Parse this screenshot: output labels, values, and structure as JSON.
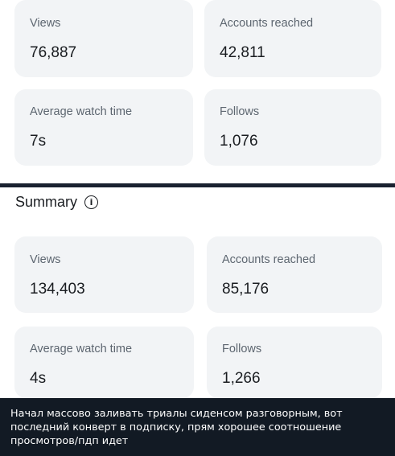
{
  "top_stats": {
    "views": {
      "label": "Views",
      "value": "76,887"
    },
    "accounts_reached": {
      "label": "Accounts reached",
      "value": "42,811"
    },
    "average_watch_time": {
      "label": "Average watch time",
      "value": "7s"
    },
    "follows": {
      "label": "Follows",
      "value": "1,076"
    }
  },
  "summary": {
    "title": "Summary",
    "info_icon": "info-circle-icon",
    "views": {
      "label": "Views",
      "value": "134,403"
    },
    "accounts_reached": {
      "label": "Accounts reached",
      "value": "85,176"
    },
    "average_watch_time": {
      "label": "Average watch time",
      "value": "4s"
    },
    "follows": {
      "label": "Follows",
      "value": "1,266"
    }
  },
  "caption": {
    "text": "Начал массово заливать триалы сиденсом разговорным, вот последний конверт в подписку, прям хорошее соотношение просмотров/пдп идет"
  },
  "colors": {
    "card_bg": "#f2f4f6",
    "divider": "#1a2230",
    "caption_bg": "#121a24"
  }
}
